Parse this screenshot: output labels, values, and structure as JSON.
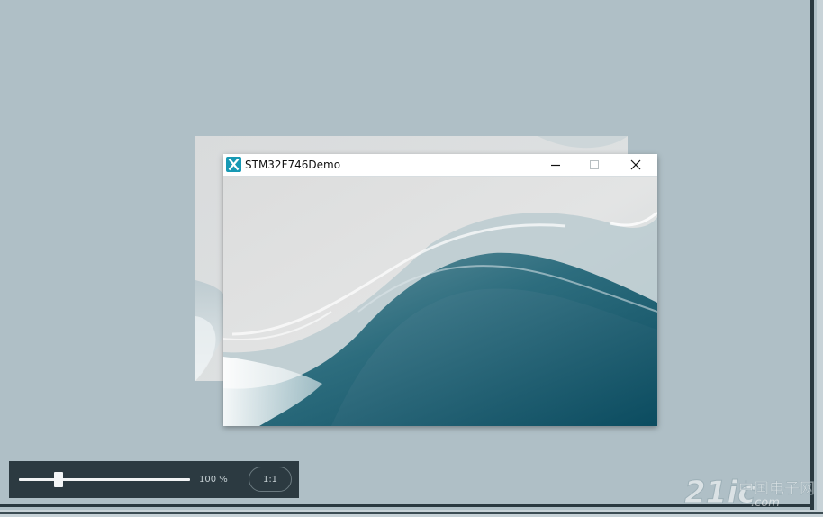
{
  "window": {
    "title": "STM32F746Demo"
  },
  "toolbar": {
    "zoom_level": "100 %",
    "zoom_fraction": 0.23,
    "reset_label": "1:1"
  },
  "watermark": {
    "text": "21ic.com中国电子网"
  },
  "icons": {
    "app": "app-x-icon",
    "minimize": "minimize-icon",
    "maximize": "maximize-icon",
    "close": "close-icon"
  },
  "colors": {
    "desktop": "#afbfc6",
    "toolbar": "#2c3a41",
    "app_icon": "#1799b4",
    "wave_dark": "#0c4f63"
  }
}
